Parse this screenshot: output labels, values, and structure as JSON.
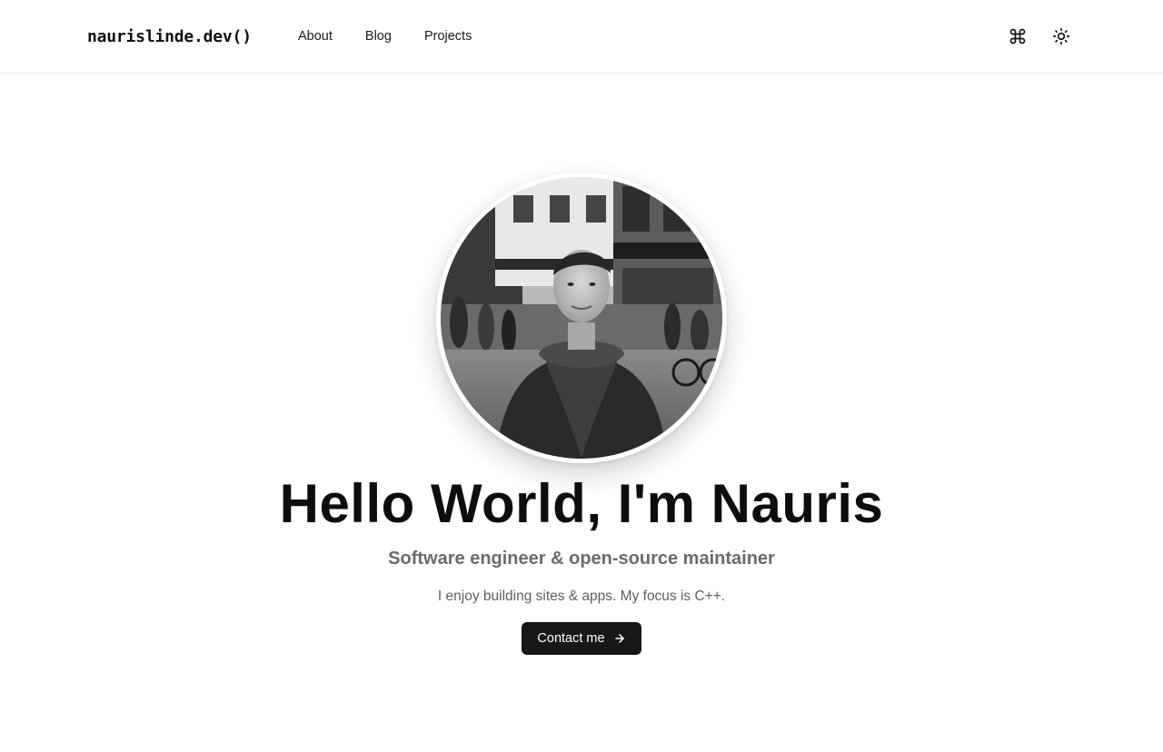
{
  "header": {
    "logo": "naurislinde.dev()",
    "nav": [
      {
        "label": "About"
      },
      {
        "label": "Blog"
      },
      {
        "label": "Projects"
      }
    ],
    "actions": {
      "command_icon": "command-icon",
      "theme_icon": "sun-icon"
    }
  },
  "hero": {
    "avatar_icon": "profile-photo",
    "title": "Hello World, I'm Nauris",
    "subtitle": "Software engineer & open-source maintainer",
    "text": "I enjoy building sites & apps. My focus is C++.",
    "cta_label": "Contact me",
    "cta_icon": "arrow-right-icon"
  },
  "colors": {
    "background": "#ffffff",
    "text": "#0d0d0d",
    "muted": "#6b6b6b",
    "button": "#171717",
    "border": "#e5e5e5"
  }
}
